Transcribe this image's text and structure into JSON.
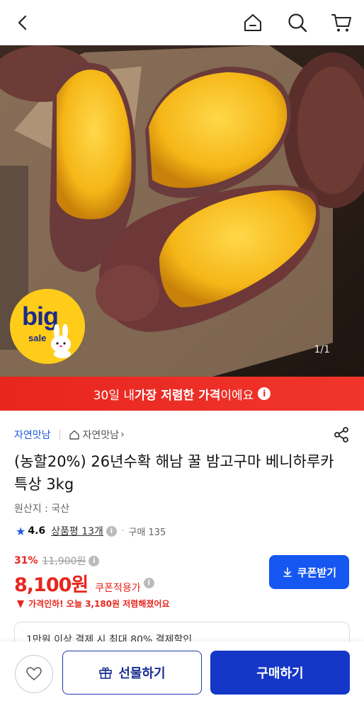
{
  "header": {
    "back_icon": "chevron-left-icon",
    "home_icon": "home-icon",
    "search_icon": "search-icon",
    "cart_icon": "cart-icon"
  },
  "hero": {
    "counter": "1/1",
    "badge_big": "big",
    "badge_sale": "sale"
  },
  "banner": {
    "prefix": "30일 내 ",
    "highlight": "가장 저렴한 가격",
    "suffix": "이에요",
    "info": "i"
  },
  "product": {
    "seller": "자연맛남",
    "store_label": "자연맛남",
    "store_chevron": "›",
    "title": "(농할20%) 26년수확 해남 꿀 밤고구마 베니하루카 특상 3kg",
    "origin": "원산지 : 국산",
    "rating": "4.6",
    "reviews": "상품평 13개",
    "separator": "·",
    "sold": "구매 135",
    "discount_pct": "31%",
    "original_price": "11,900원",
    "price": "8,100원",
    "price_tag": "쿠폰적용가",
    "coupon_button": "쿠폰받기",
    "price_drop": "가격인하! 오늘 3,180원 저렴해졌어요",
    "card_text": "1만원 이상 결제 시 최대 80% 결제할인"
  },
  "bottom": {
    "gift_label": "선물하기",
    "buy_label": "구매하기"
  },
  "colors": {
    "accent_blue": "#1557f0",
    "sale_red": "#e8261e",
    "buy_navy": "#1537c8"
  }
}
